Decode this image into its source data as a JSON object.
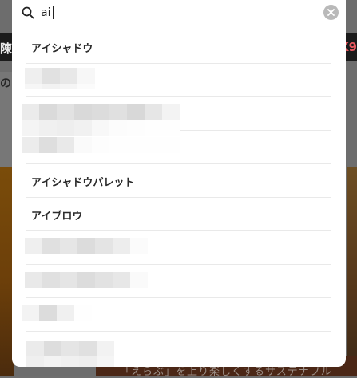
{
  "background": {
    "left_edge_text": "陳",
    "right_edge_text": "K9",
    "left_char": "の",
    "bottom_text": "「えらぶ」を上り楽しくするサステナブル"
  },
  "search": {
    "query": "ai",
    "icon": "search-icon",
    "clear_icon": "close-icon"
  },
  "suggestions": [
    {
      "label": "アイシャドウ"
    },
    {
      "label": ""
    },
    {
      "label": ""
    },
    {
      "label": ""
    },
    {
      "label": "アイシャドウパレット"
    },
    {
      "label": "アイブロウ"
    },
    {
      "label": ""
    },
    {
      "label": ""
    },
    {
      "label": ""
    },
    {
      "label": ""
    }
  ],
  "colors": {
    "overlay": "#6d6d6d",
    "panel": "#ffffff",
    "divider": "#e9e9e9",
    "clear_button": "#b9b9b9"
  }
}
